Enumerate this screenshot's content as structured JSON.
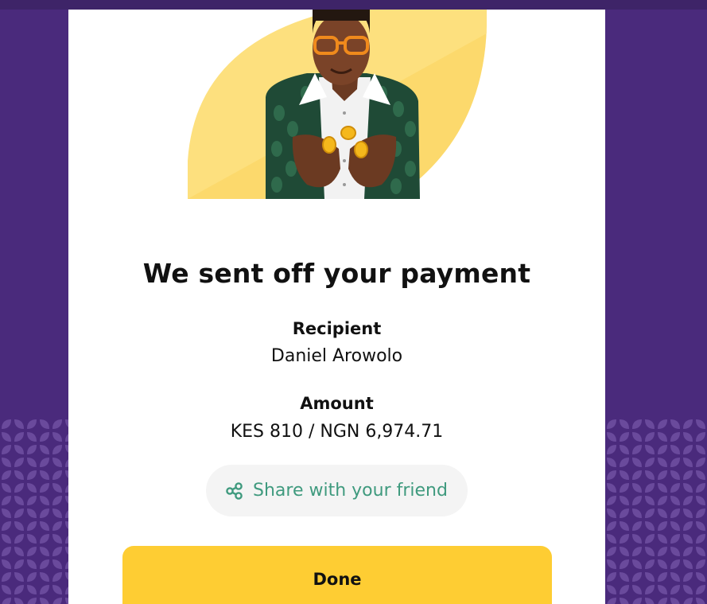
{
  "confirmation": {
    "title": "We sent off your payment",
    "recipient_label": "Recipient",
    "recipient_name": "Daniel Arowolo",
    "amount_label": "Amount",
    "amount_value": "KES 810 / NGN 6,974.71"
  },
  "actions": {
    "share_label": "Share with your friend",
    "done_label": "Done"
  },
  "colors": {
    "background": "#4a2a7c",
    "accent_yellow": "#fecd33",
    "share_text": "#3f9a7e"
  },
  "icons": {
    "share": "share-icon",
    "illustration": "man-with-coins-illustration"
  }
}
